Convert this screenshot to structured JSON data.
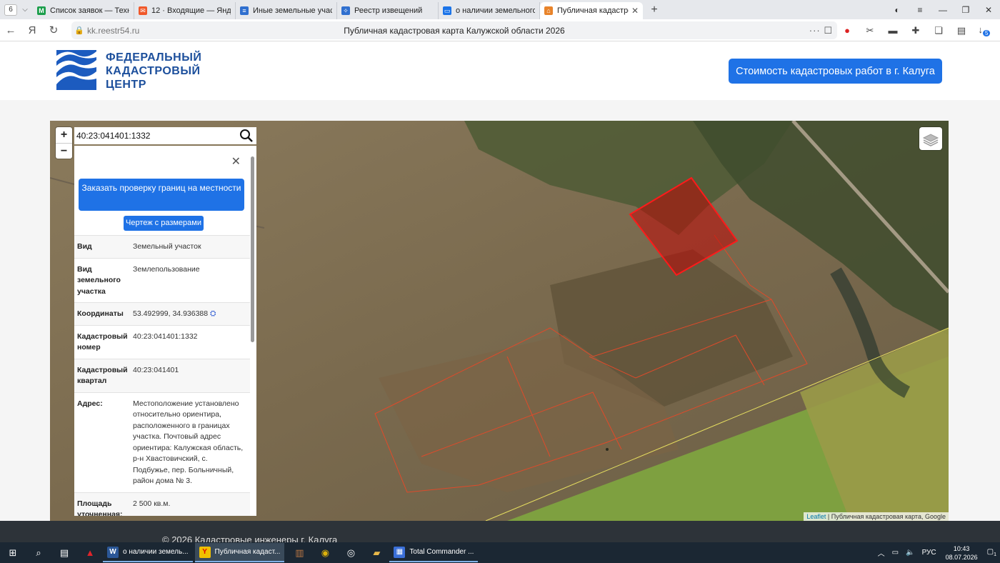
{
  "browser": {
    "tab_count": "6",
    "tabs": [
      {
        "title": "Список заявок — ТехноКа",
        "icon_color": "#1b9e4b",
        "icon_glyph": "M"
      },
      {
        "title": "12 · Входящие — Яндекс Г",
        "icon_color": "#f0582a",
        "icon_glyph": "✉"
      },
      {
        "title": "Иные земельные участки",
        "icon_color": "#2f6fcf",
        "icon_glyph": "≡"
      },
      {
        "title": "Реестр извещений",
        "icon_color": "#2f6fcf",
        "icon_glyph": "✧"
      },
      {
        "title": "о наличии земельного уч",
        "icon_color": "#1a73e8",
        "icon_glyph": "▭"
      },
      {
        "title": "Публичная кадастрова",
        "icon_color": "#e8832a",
        "icon_glyph": "⌂",
        "active": true
      }
    ],
    "url_domain": "kk.reestr54.ru",
    "page_title": "Публичная кадастровая карта Калужской области 2026",
    "notification_badge": "5"
  },
  "site": {
    "logo_lines": [
      "ФЕДЕРАЛЬНЫЙ",
      "КАДАСТРОВЫЙ",
      "ЦЕНТР"
    ],
    "cta_label": "Стоимость кадастровых работ в г. Калуга"
  },
  "map": {
    "search_value": "40:23:041401:1332",
    "zoom_in": "+",
    "zoom_out": "−",
    "attribution_link": "Leaflet",
    "attribution_text": " | Публичная кадастровая карта, Google"
  },
  "panel": {
    "order_button": "Заказать проверку границ на местности",
    "drawing_button": "Чертеж с размерами",
    "rows": [
      {
        "key": "Вид",
        "value": "Земельный участок"
      },
      {
        "key": "Вид земельного участка",
        "value": "Землепользование"
      },
      {
        "key": "Координаты",
        "value": "53.492999, 34.936388"
      },
      {
        "key": "Кадастровый номер",
        "value": "40:23:041401:1332"
      },
      {
        "key": "Кадастровый квартал",
        "value": "40:23:041401"
      },
      {
        "key": "Адрес:",
        "value": "Местоположение установлено относительно ориентира, расположенного в границах участка. Почтовый адрес ориентира: Калужская область, р-н Хвастовичский, с. Подбужье, пер. Больничный, район дома № 3."
      },
      {
        "key": "Площадь уточненная:",
        "value": "2 500 кв.м."
      }
    ]
  },
  "footer": {
    "copyright": "© 2026 Кадастровые инженеры г. Калуга"
  },
  "taskbar": {
    "apps": [
      {
        "label": "о наличии земель...",
        "icon_color": "#2b5797",
        "glyph": "W"
      },
      {
        "label": "Публичная кадаст...",
        "icon_color": "#f0c000",
        "glyph": "Y",
        "active": true
      },
      {
        "label": "Total Commander ...",
        "icon_color": "#3a6fd8",
        "glyph": "▦"
      }
    ],
    "language": "РУС",
    "time": "10:43",
    "date": "08.07.2026",
    "notifications": "1"
  }
}
